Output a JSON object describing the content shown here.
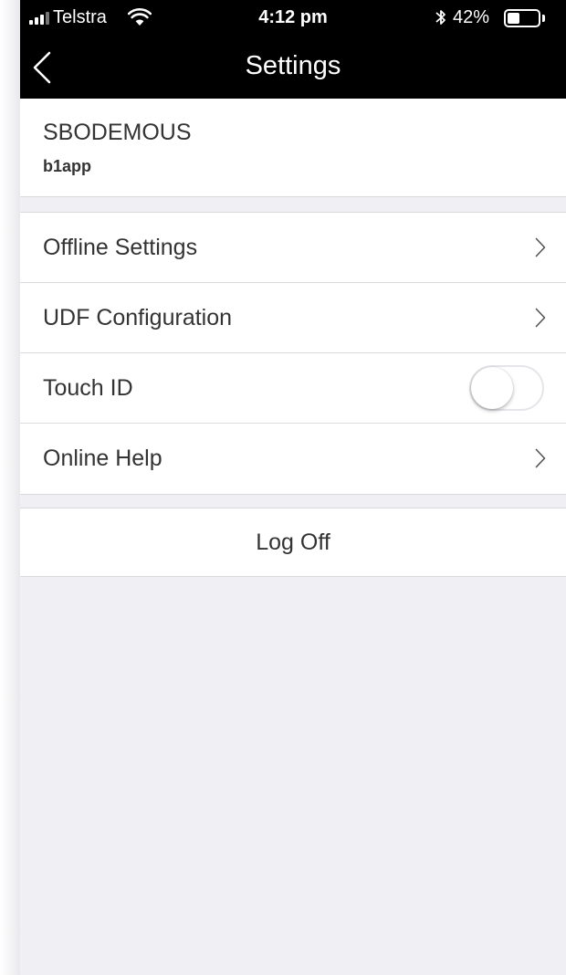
{
  "status_bar": {
    "carrier": "Telstra",
    "time": "4:12 pm",
    "battery": "42%",
    "battery_level": 0.42,
    "icons": [
      "signal-icon",
      "wifi-icon",
      "bluetooth-icon",
      "battery-icon"
    ]
  },
  "nav": {
    "title": "Settings",
    "back_icon": "chevron-left-icon"
  },
  "account": {
    "name": "SBODEMOUS",
    "sub": "b1app"
  },
  "rows": [
    {
      "label": "Offline Settings",
      "accessory": "chevron-right-icon"
    },
    {
      "label": "UDF Configuration",
      "accessory": "chevron-right-icon"
    },
    {
      "label": "Touch ID",
      "accessory": "toggle",
      "toggle_on": false
    },
    {
      "label": "Online Help",
      "accessory": "chevron-right-icon"
    }
  ],
  "logoff": {
    "label": "Log Off"
  },
  "colors": {
    "nav_background": "#000000",
    "page_background": "#efeff4",
    "text": "#333333",
    "separator": "#d9d9de"
  }
}
